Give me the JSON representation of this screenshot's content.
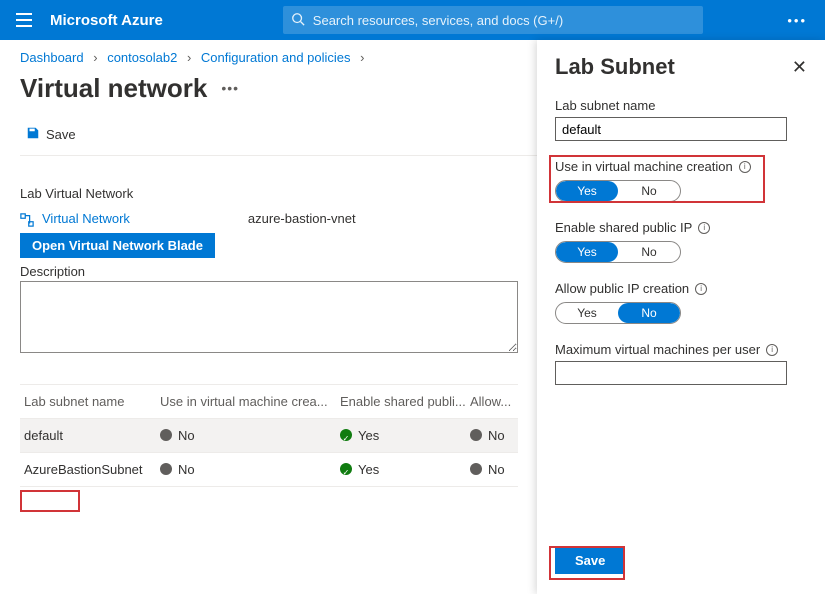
{
  "header": {
    "brand": "Microsoft Azure",
    "search_placeholder": "Search resources, services, and docs (G+/)"
  },
  "breadcrumb": {
    "items": [
      "Dashboard",
      "contosolab2",
      "Configuration and policies"
    ]
  },
  "page": {
    "title": "Virtual network"
  },
  "toolbar": {
    "save_label": "Save"
  },
  "vnet": {
    "section_heading": "Lab Virtual Network",
    "link_label": "Virtual Network",
    "value": "azure-bastion-vnet",
    "open_blade_label": "Open Virtual Network Blade",
    "description_label": "Description",
    "description_value": ""
  },
  "table": {
    "columns": [
      "Lab subnet name",
      "Use in virtual machine crea...",
      "Enable shared publi...",
      "Allow..."
    ],
    "rows": [
      {
        "name": "default",
        "use_vm": "No",
        "use_vm_status": "gray",
        "shared_ip": "Yes",
        "shared_ip_status": "green",
        "allow": "No",
        "allow_status": "gray",
        "selected": true
      },
      {
        "name": "AzureBastionSubnet",
        "use_vm": "No",
        "use_vm_status": "gray",
        "shared_ip": "Yes",
        "shared_ip_status": "green",
        "allow": "No",
        "allow_status": "gray",
        "selected": false
      }
    ]
  },
  "panel": {
    "title": "Lab Subnet",
    "fields": {
      "name_label": "Lab subnet name",
      "name_value": "default",
      "use_vm_label": "Use in virtual machine creation",
      "use_vm_yes": "Yes",
      "use_vm_no": "No",
      "use_vm_value": "Yes",
      "shared_ip_label": "Enable shared public IP",
      "shared_ip_yes": "Yes",
      "shared_ip_no": "No",
      "shared_ip_value": "Yes",
      "allow_ip_label": "Allow public IP creation",
      "allow_ip_yes": "Yes",
      "allow_ip_no": "No",
      "allow_ip_value": "No",
      "max_vm_label": "Maximum virtual machines per user",
      "max_vm_value": ""
    },
    "save_label": "Save"
  }
}
